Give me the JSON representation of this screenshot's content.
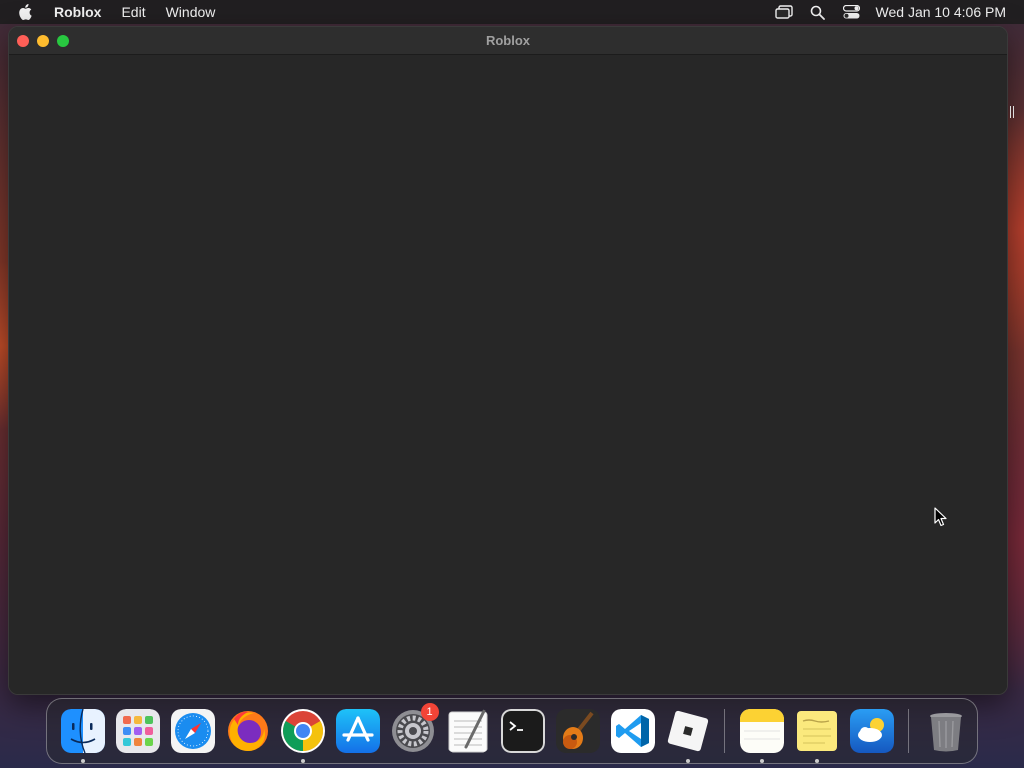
{
  "menubar": {
    "app_name": "Roblox",
    "items": [
      "Edit",
      "Window"
    ],
    "clock": "Wed Jan 10  4:06 PM"
  },
  "window": {
    "title": "Roblox"
  },
  "dock": {
    "apps": [
      {
        "name": "Finder",
        "running": true
      },
      {
        "name": "Launchpad",
        "running": false
      },
      {
        "name": "Safari",
        "running": false
      },
      {
        "name": "Firefox",
        "running": false
      },
      {
        "name": "Chrome",
        "running": true
      },
      {
        "name": "App Store",
        "running": false
      },
      {
        "name": "System Settings",
        "running": false,
        "badge": "1"
      },
      {
        "name": "TextEdit",
        "running": false
      },
      {
        "name": "Terminal",
        "running": false
      },
      {
        "name": "GarageBand",
        "running": false
      },
      {
        "name": "Visual Studio Code",
        "running": false
      },
      {
        "name": "Roblox",
        "running": true
      },
      {
        "name": "Notes",
        "running": true
      },
      {
        "name": "Stickies",
        "running": true
      },
      {
        "name": "Weather",
        "running": false
      },
      {
        "name": "Trash",
        "running": false
      }
    ]
  }
}
